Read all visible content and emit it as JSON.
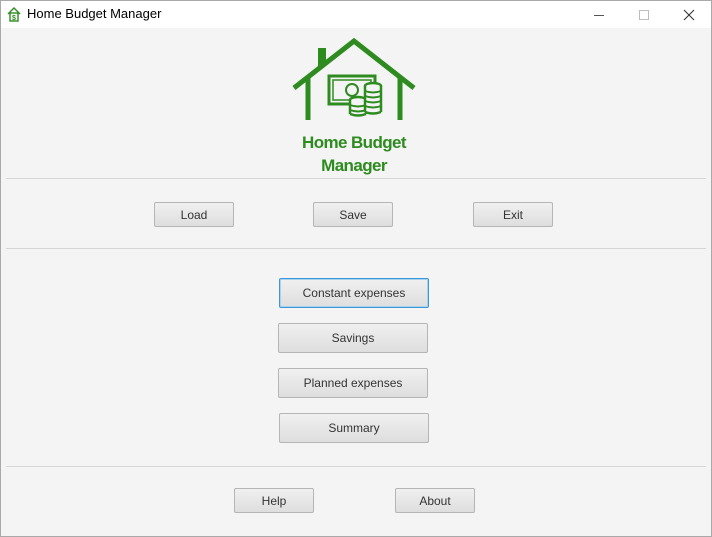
{
  "window": {
    "title": "Home Budget Manager",
    "icon": "house-dollar-icon"
  },
  "controls": {
    "minimize_icon": "minimize-icon",
    "maximize_icon": "maximize-icon",
    "close_icon": "close-icon"
  },
  "logo": {
    "line1": "Home Budget",
    "line2": "Manager",
    "icon": "house-money-icon",
    "color": "#2e8b1f"
  },
  "file_actions": {
    "load": "Load",
    "save": "Save",
    "exit": "Exit"
  },
  "main_menu": {
    "constant_expenses": "Constant expenses",
    "savings": "Savings",
    "planned_expenses": "Planned expenses",
    "summary": "Summary"
  },
  "footer": {
    "help": "Help",
    "about": "About"
  },
  "colors": {
    "focus": "#3d97d4",
    "background": "#f4f4f4"
  }
}
